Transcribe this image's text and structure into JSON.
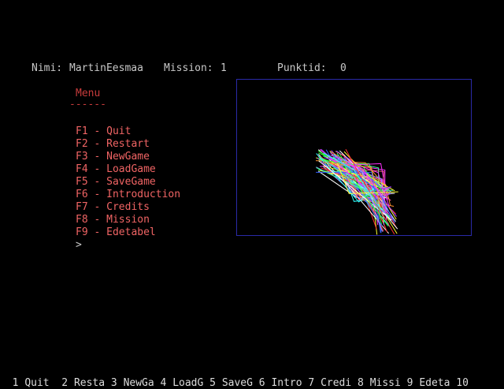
{
  "status": {
    "name_label": "Nimi:",
    "name_value": "MartinEesmaa",
    "mission_label": "Mission:",
    "mission_value": "1",
    "points_label": "Punktid:",
    "points_value": "0"
  },
  "menu": {
    "title": "Menu",
    "underline": "------",
    "items": [
      {
        "label": "F1 - Quit"
      },
      {
        "label": "F2 - Restart"
      },
      {
        "label": "F3 - NewGame"
      },
      {
        "label": "F4 - LoadGame"
      },
      {
        "label": "F5 - SaveGame"
      },
      {
        "label": "F6 - Introduction"
      },
      {
        "label": "F7 - Credits"
      },
      {
        "label": "F8 - Mission"
      },
      {
        "label": "F9 - Edetabel"
      }
    ],
    "prompt": ">"
  },
  "fkeys": [
    {
      "num": "1",
      "label": "Quit"
    },
    {
      "num": "2",
      "label": "Resta"
    },
    {
      "num": "3",
      "label": "NewGa"
    },
    {
      "num": "4",
      "label": "LoadG"
    },
    {
      "num": "5",
      "label": "SaveG"
    },
    {
      "num": "6",
      "label": "Intro"
    },
    {
      "num": "7",
      "label": "Credi"
    },
    {
      "num": "8",
      "label": "Missi"
    },
    {
      "num": "9",
      "label": "Edeta"
    },
    {
      "num": "10",
      "label": ""
    }
  ],
  "colors": {
    "background": "#000000",
    "text": "#c8c8c8",
    "menu_title": "#c83c3c",
    "menu_item": "#f06464",
    "viewport_border": "#2a2aa8",
    "line_palette": [
      "#ff3030",
      "#30ff30",
      "#3060ff",
      "#ffff30",
      "#ff30ff",
      "#30ffff",
      "#ff9030",
      "#ffffff",
      "#a040ff",
      "#40ffa0",
      "#ff6090",
      "#9090ff"
    ]
  }
}
